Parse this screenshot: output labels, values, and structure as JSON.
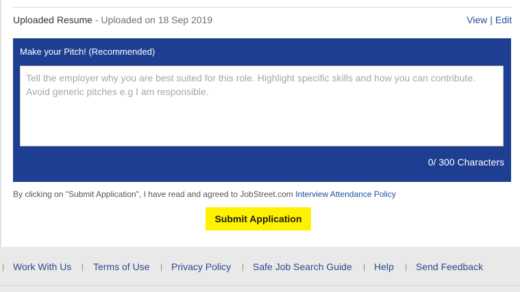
{
  "resume": {
    "label": "Uploaded Resume",
    "separator": " - ",
    "uploaded_text": "Uploaded on 18 Sep 2019",
    "view_label": "View",
    "divider": "|",
    "edit_label": "Edit"
  },
  "pitch": {
    "title": "Make your Pitch! (Recommended)",
    "value": "",
    "placeholder": "Tell the employer why you are best suited for this role. Highlight specific skills and how you can contribute. Avoid generic pitches e.g I am responsible.",
    "char_count": "0/ 300 Characters"
  },
  "agreement": {
    "text": "By clicking on \"Submit Application\", I have read and agreed to JobStreet.com ",
    "link": "Interview Attendance Policy"
  },
  "submit_label": "Submit Application",
  "footer": {
    "separator": "|",
    "links": [
      "Work With Us",
      "Terms of Use",
      "Privacy Policy",
      "Safe Job Search Guide",
      "Help",
      "Send Feedback"
    ]
  },
  "colors": {
    "pitch_panel": "#1e3e91",
    "submit_button": "#fff200",
    "link": "#1f4fa0",
    "page_background": "#e9e9e9"
  }
}
